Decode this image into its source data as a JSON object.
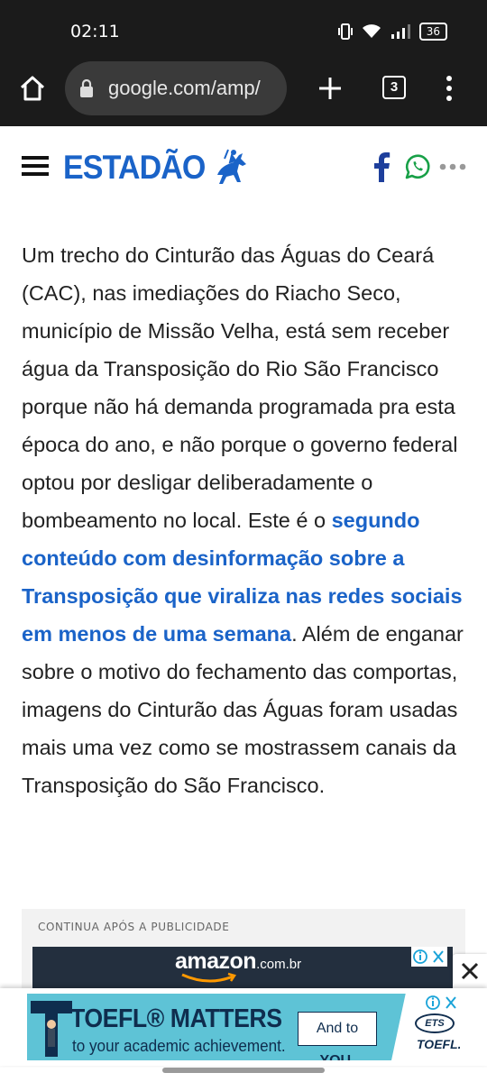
{
  "status_bar": {
    "time": "02:11",
    "battery": "36",
    "icons": [
      "vibrate-icon",
      "wifi-icon",
      "signal-icon",
      "battery-icon"
    ]
  },
  "browser": {
    "url": "google.com/amp/",
    "tab_count": "3",
    "icons": [
      "home-icon",
      "lock-icon",
      "plus-icon",
      "tabs-icon",
      "menu-icon"
    ]
  },
  "site": {
    "logo": "ESTADÃO",
    "brand_color": "#1a63c8",
    "icons": [
      "hamburger-icon",
      "horse-rider-icon",
      "facebook-icon",
      "whatsapp-icon",
      "more-icon"
    ]
  },
  "article": {
    "para_start": "Um trecho do Cinturão das Águas do Ceará (CAC), nas imediações do Riacho Seco, município de Missão Velha, está sem receber água da Transposição do Rio São Francisco porque não há demanda programada pra esta época do ano, e não porque o governo federal optou por desligar deliberadamente o bombeamento no local. Este é o ",
    "link": "segundo conteúdo com desinformação sobre a Transposição que viraliza nas redes sociais em menos de uma semana",
    "para_end": ". Além de enganar sobre o motivo do fechamento das comportas, imagens do Cinturão das Águas foram usadas mais uma vez como se mostrassem canais da Transposição do São Francisco."
  },
  "ad": {
    "label": "CONTINUA APÓS A PUBLICIDADE",
    "amazon_word": "amazon",
    "amazon_suffix": ".com.br"
  },
  "sticky_ad": {
    "title": "TOEFL® MATTERS",
    "subtitle": "to your academic achievement.",
    "cta_prefix": "And to ",
    "cta_emphasis": "YOU.",
    "ets": "ETS",
    "brand": "TOEFL."
  }
}
